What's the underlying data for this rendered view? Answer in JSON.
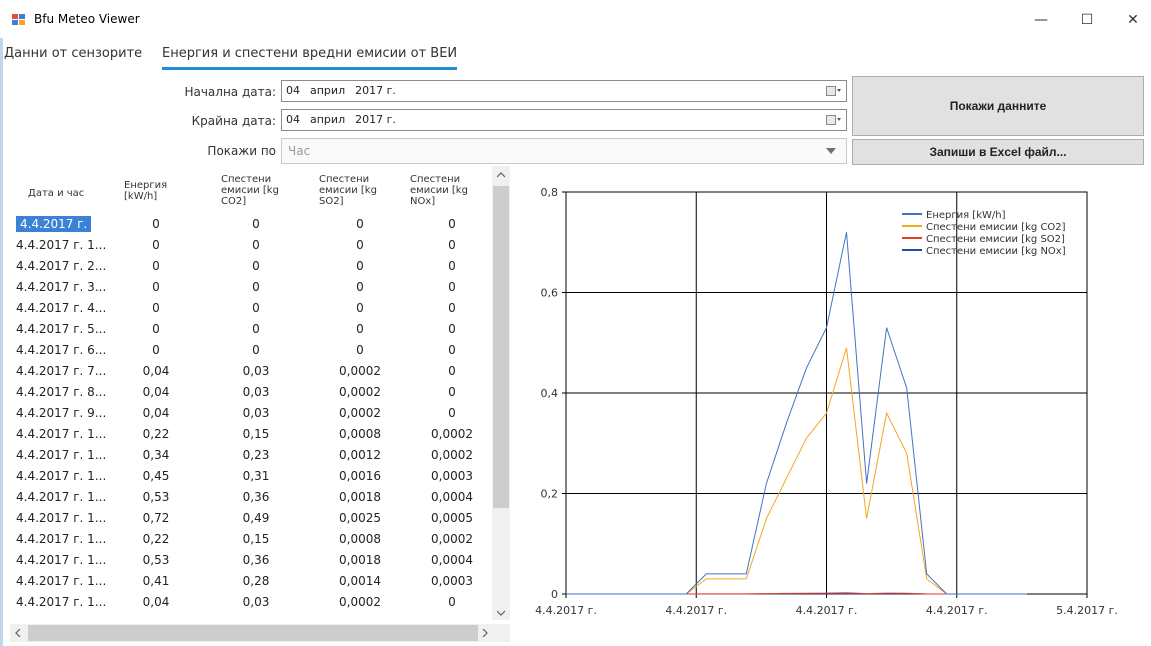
{
  "window": {
    "title": "Bfu Meteo Viewer",
    "controls": [
      "—",
      "☐",
      "✕"
    ]
  },
  "tabs": [
    {
      "label": "Данни от сензорите",
      "active": false
    },
    {
      "label": "Енергия и спестени вредни емисии от ВЕИ",
      "active": true
    }
  ],
  "form": {
    "start_label": "Начална дата:",
    "start_day": "04",
    "start_month": "април",
    "start_year": "2017 г.",
    "end_label": "Крайна дата:",
    "end_day": "04",
    "end_month": "април",
    "end_year": "2017 г.",
    "show_by_label": "Покажи по",
    "show_by_value": "Час"
  },
  "buttons": {
    "show": "Покажи данните",
    "export": "Запиши в Excel файл..."
  },
  "grid": {
    "headers": [
      [
        "Дата и час"
      ],
      [
        "Енергия",
        "[kW/h]"
      ],
      [
        "Спестени",
        "емисии [kg",
        "CO2]"
      ],
      [
        "Спестени",
        "емисии [kg",
        "SO2]"
      ],
      [
        "Спестени",
        "емисии [kg",
        "NOx]"
      ]
    ],
    "rows": [
      [
        "4.4.2017 г.",
        "0",
        "0",
        "0",
        "0"
      ],
      [
        "4.4.2017 г. 1...",
        "0",
        "0",
        "0",
        "0"
      ],
      [
        "4.4.2017 г. 2...",
        "0",
        "0",
        "0",
        "0"
      ],
      [
        "4.4.2017 г. 3...",
        "0",
        "0",
        "0",
        "0"
      ],
      [
        "4.4.2017 г. 4...",
        "0",
        "0",
        "0",
        "0"
      ],
      [
        "4.4.2017 г. 5...",
        "0",
        "0",
        "0",
        "0"
      ],
      [
        "4.4.2017 г. 6...",
        "0",
        "0",
        "0",
        "0"
      ],
      [
        "4.4.2017 г. 7...",
        "0,04",
        "0,03",
        "0,0002",
        "0"
      ],
      [
        "4.4.2017 г. 8...",
        "0,04",
        "0,03",
        "0,0002",
        "0"
      ],
      [
        "4.4.2017 г. 9...",
        "0,04",
        "0,03",
        "0,0002",
        "0"
      ],
      [
        "4.4.2017 г. 1...",
        "0,22",
        "0,15",
        "0,0008",
        "0,0002"
      ],
      [
        "4.4.2017 г. 1...",
        "0,34",
        "0,23",
        "0,0012",
        "0,0002"
      ],
      [
        "4.4.2017 г. 1...",
        "0,45",
        "0,31",
        "0,0016",
        "0,0003"
      ],
      [
        "4.4.2017 г. 1...",
        "0,53",
        "0,36",
        "0,0018",
        "0,0004"
      ],
      [
        "4.4.2017 г. 1...",
        "0,72",
        "0,49",
        "0,0025",
        "0,0005"
      ],
      [
        "4.4.2017 г. 1...",
        "0,22",
        "0,15",
        "0,0008",
        "0,0002"
      ],
      [
        "4.4.2017 г. 1...",
        "0,53",
        "0,36",
        "0,0018",
        "0,0004"
      ],
      [
        "4.4.2017 г. 1...",
        "0,41",
        "0,28",
        "0,0014",
        "0,0003"
      ],
      [
        "4.4.2017 г. 1...",
        "0,04",
        "0,03",
        "0,0002",
        "0"
      ]
    ]
  },
  "colors": {
    "selection": "#3b82d6",
    "tab_underline": "#1e8fd6",
    "energy": "#4472c4",
    "co2": "#f5a623",
    "so2": "#e8392a",
    "nox": "#1f4e9a"
  },
  "chart_data": {
    "type": "line",
    "x_tick_labels": [
      "4.4.2017 г.",
      "4.4.2017 г.",
      "4.4.2017 г.",
      "4.4.2017 г.",
      "5.4.2017 г."
    ],
    "x_hours": [
      0,
      1,
      2,
      3,
      4,
      5,
      6,
      7,
      8,
      9,
      10,
      11,
      12,
      13,
      14,
      15,
      16,
      17,
      18,
      19,
      20,
      21,
      22,
      23
    ],
    "x_range_hours": [
      0,
      26
    ],
    "ylim": [
      0,
      0.8
    ],
    "y_ticks": [
      "0",
      "0,2",
      "0,4",
      "0,6",
      "0,8"
    ],
    "grid": true,
    "legend_position": "top-right",
    "series": [
      {
        "name": "Енергия [kW/h]",
        "color": "#4472c4",
        "values": [
          0,
          0,
          0,
          0,
          0,
          0,
          0,
          0.04,
          0.04,
          0.04,
          0.22,
          0.34,
          0.45,
          0.53,
          0.72,
          0.22,
          0.53,
          0.41,
          0.04,
          0,
          0,
          0,
          0,
          0
        ]
      },
      {
        "name": "Спестени емисии [kg CO2]",
        "color": "#f5a623",
        "values": [
          0,
          0,
          0,
          0,
          0,
          0,
          0,
          0.03,
          0.03,
          0.03,
          0.15,
          0.23,
          0.31,
          0.36,
          0.49,
          0.15,
          0.36,
          0.28,
          0.03,
          0,
          0,
          0,
          0,
          0
        ]
      },
      {
        "name": "Спестени емисии [kg SO2]",
        "color": "#e8392a",
        "values": [
          0,
          0,
          0,
          0,
          0,
          0,
          0,
          0.0002,
          0.0002,
          0.0002,
          0.0008,
          0.0012,
          0.0016,
          0.0018,
          0.0025,
          0.0008,
          0.0018,
          0.0014,
          0.0002,
          0,
          0,
          0,
          0,
          0
        ]
      },
      {
        "name": "Спестени емисии [kg NOx]",
        "color": "#1f4e9a",
        "values": [
          0,
          0,
          0,
          0,
          0,
          0,
          0,
          0,
          0,
          0,
          0.0002,
          0.0002,
          0.0003,
          0.0004,
          0.0005,
          0.0002,
          0.0004,
          0.0003,
          0,
          0,
          0,
          0,
          0,
          0
        ]
      }
    ]
  }
}
